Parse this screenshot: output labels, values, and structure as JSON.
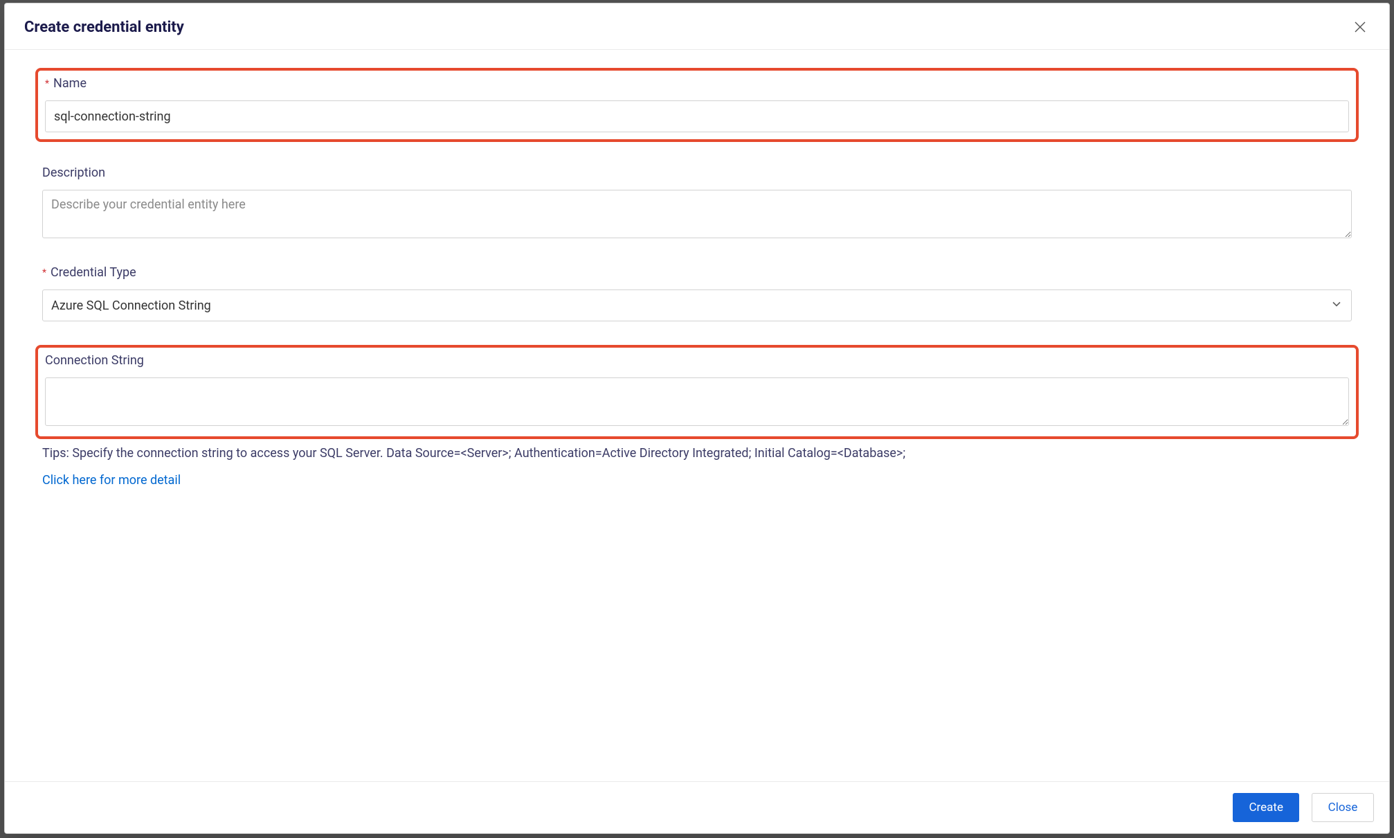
{
  "modal": {
    "title": "Create credential entity",
    "fields": {
      "name": {
        "label": "Name",
        "value": "sql-connection-string",
        "required_mark": "*"
      },
      "description": {
        "label": "Description",
        "placeholder": "Describe your credential entity here",
        "value": ""
      },
      "credential_type": {
        "label": "Credential Type",
        "required_mark": "*",
        "selected": "Azure SQL Connection String"
      },
      "connection_string": {
        "label": "Connection String",
        "value": ""
      }
    },
    "tips": "Tips: Specify the connection string to access your SQL Server. Data Source=<Server>; Authentication=Active Directory Integrated; Initial Catalog=<Database>;",
    "more_link": "Click here for more detail",
    "footer": {
      "create": "Create",
      "close": "Close"
    }
  }
}
